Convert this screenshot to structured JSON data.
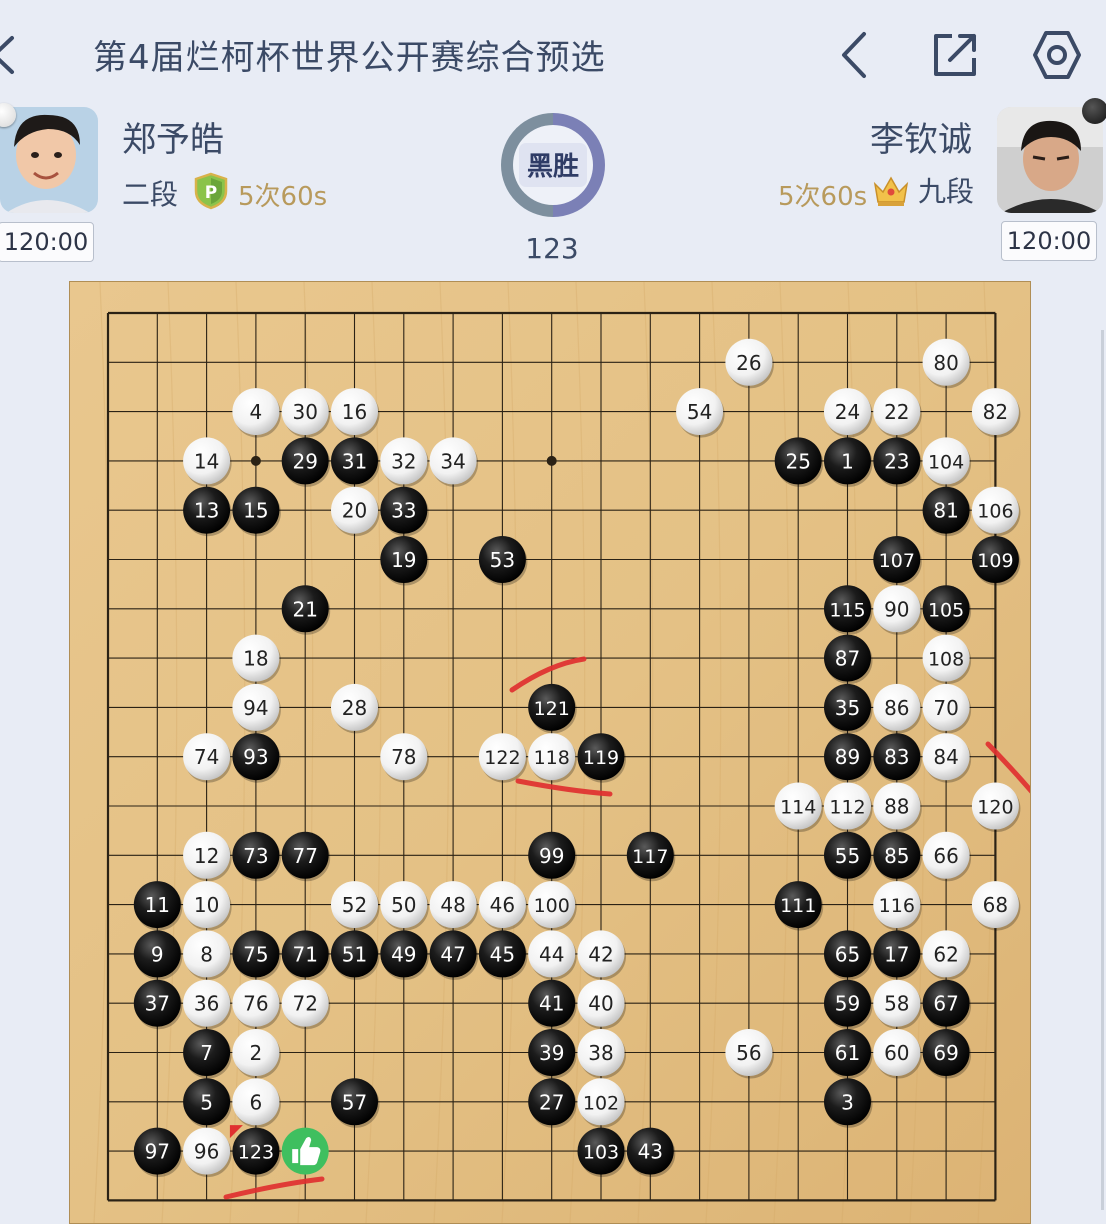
{
  "header": {
    "title": "第4届烂柯杯世界公开赛综合预选",
    "back_icon": "chevron-left-icon",
    "prev_icon": "chevron-left-icon",
    "share_icon": "share-icon",
    "settings_icon": "gear-icon"
  },
  "players": {
    "black": {
      "name": "郑予皓",
      "rank": "二段",
      "byoyomi": "5次60s",
      "clock": "120:00",
      "badge_icon": "p-shield-icon"
    },
    "white": {
      "name": "李钦诚",
      "rank": "九段",
      "byoyomi": "5次60s",
      "clock": "120:00",
      "badge_icon": "crown-icon"
    }
  },
  "result": {
    "label": "黑胜",
    "move_count": "123"
  },
  "colors": {
    "black_stone": "#1c1c1c",
    "white_stone": "#f2f2f2",
    "board": "#e4c185",
    "annotation": "#e03030",
    "ring_left": "#7d8f9e",
    "ring_right": "#7b80b6"
  },
  "board": {
    "size": 19,
    "stones": [
      {
        "n": "26",
        "c": "w",
        "col": 13,
        "row": 1
      },
      {
        "n": "80",
        "c": "w",
        "col": 17,
        "row": 1
      },
      {
        "n": "4",
        "c": "w",
        "col": 3,
        "row": 2
      },
      {
        "n": "30",
        "c": "w",
        "col": 4,
        "row": 2
      },
      {
        "n": "16",
        "c": "w",
        "col": 5,
        "row": 2
      },
      {
        "n": "54",
        "c": "w",
        "col": 12,
        "row": 2
      },
      {
        "n": "24",
        "c": "w",
        "col": 15,
        "row": 2
      },
      {
        "n": "22",
        "c": "w",
        "col": 16,
        "row": 2
      },
      {
        "n": "82",
        "c": "w",
        "col": 18,
        "row": 2
      },
      {
        "n": "14",
        "c": "w",
        "col": 2,
        "row": 3
      },
      {
        "n": "29",
        "c": "b",
        "col": 4,
        "row": 3
      },
      {
        "n": "31",
        "c": "b",
        "col": 5,
        "row": 3
      },
      {
        "n": "32",
        "c": "w",
        "col": 6,
        "row": 3
      },
      {
        "n": "34",
        "c": "w",
        "col": 7,
        "row": 3
      },
      {
        "n": "25",
        "c": "b",
        "col": 14,
        "row": 3
      },
      {
        "n": "1",
        "c": "b",
        "col": 15,
        "row": 3
      },
      {
        "n": "23",
        "c": "b",
        "col": 16,
        "row": 3
      },
      {
        "n": "104",
        "c": "w",
        "col": 17,
        "row": 3
      },
      {
        "n": "13",
        "c": "b",
        "col": 2,
        "row": 4
      },
      {
        "n": "15",
        "c": "b",
        "col": 3,
        "row": 4
      },
      {
        "n": "20",
        "c": "w",
        "col": 5,
        "row": 4
      },
      {
        "n": "33",
        "c": "b",
        "col": 6,
        "row": 4
      },
      {
        "n": "81",
        "c": "b",
        "col": 17,
        "row": 4
      },
      {
        "n": "106",
        "c": "w",
        "col": 18,
        "row": 4
      },
      {
        "n": "19",
        "c": "b",
        "col": 6,
        "row": 5
      },
      {
        "n": "53",
        "c": "b",
        "col": 8,
        "row": 5
      },
      {
        "n": "107",
        "c": "b",
        "col": 16,
        "row": 5
      },
      {
        "n": "109",
        "c": "b",
        "col": 18,
        "row": 5
      },
      {
        "n": "21",
        "c": "b",
        "col": 4,
        "row": 6
      },
      {
        "n": "115",
        "c": "b",
        "col": 15,
        "row": 6
      },
      {
        "n": "90",
        "c": "w",
        "col": 16,
        "row": 6
      },
      {
        "n": "105",
        "c": "b",
        "col": 17,
        "row": 6
      },
      {
        "n": "18",
        "c": "w",
        "col": 3,
        "row": 7
      },
      {
        "n": "87",
        "c": "b",
        "col": 15,
        "row": 7
      },
      {
        "n": "108",
        "c": "w",
        "col": 17,
        "row": 7
      },
      {
        "n": "94",
        "c": "w",
        "col": 3,
        "row": 8
      },
      {
        "n": "28",
        "c": "w",
        "col": 5,
        "row": 8
      },
      {
        "n": "121",
        "c": "b",
        "col": 9,
        "row": 8
      },
      {
        "n": "35",
        "c": "b",
        "col": 15,
        "row": 8
      },
      {
        "n": "86",
        "c": "w",
        "col": 16,
        "row": 8
      },
      {
        "n": "70",
        "c": "w",
        "col": 17,
        "row": 8
      },
      {
        "n": "74",
        "c": "w",
        "col": 2,
        "row": 9
      },
      {
        "n": "93",
        "c": "b",
        "col": 3,
        "row": 9
      },
      {
        "n": "78",
        "c": "w",
        "col": 6,
        "row": 9
      },
      {
        "n": "122",
        "c": "w",
        "col": 8,
        "row": 9
      },
      {
        "n": "118",
        "c": "w",
        "col": 9,
        "row": 9
      },
      {
        "n": "119",
        "c": "b",
        "col": 10,
        "row": 9
      },
      {
        "n": "89",
        "c": "b",
        "col": 15,
        "row": 9
      },
      {
        "n": "83",
        "c": "b",
        "col": 16,
        "row": 9
      },
      {
        "n": "84",
        "c": "w",
        "col": 17,
        "row": 9
      },
      {
        "n": "114",
        "c": "w",
        "col": 14,
        "row": 10
      },
      {
        "n": "112",
        "c": "w",
        "col": 15,
        "row": 10
      },
      {
        "n": "88",
        "c": "w",
        "col": 16,
        "row": 10
      },
      {
        "n": "120",
        "c": "w",
        "col": 18,
        "row": 10
      },
      {
        "n": "12",
        "c": "w",
        "col": 2,
        "row": 11
      },
      {
        "n": "73",
        "c": "b",
        "col": 3,
        "row": 11
      },
      {
        "n": "77",
        "c": "b",
        "col": 4,
        "row": 11
      },
      {
        "n": "99",
        "c": "b",
        "col": 9,
        "row": 11
      },
      {
        "n": "117",
        "c": "b",
        "col": 11,
        "row": 11
      },
      {
        "n": "55",
        "c": "b",
        "col": 15,
        "row": 11
      },
      {
        "n": "85",
        "c": "b",
        "col": 16,
        "row": 11
      },
      {
        "n": "66",
        "c": "w",
        "col": 17,
        "row": 11
      },
      {
        "n": "11",
        "c": "b",
        "col": 1,
        "row": 12
      },
      {
        "n": "10",
        "c": "w",
        "col": 2,
        "row": 12
      },
      {
        "n": "52",
        "c": "w",
        "col": 5,
        "row": 12
      },
      {
        "n": "50",
        "c": "w",
        "col": 6,
        "row": 12
      },
      {
        "n": "48",
        "c": "w",
        "col": 7,
        "row": 12
      },
      {
        "n": "46",
        "c": "w",
        "col": 8,
        "row": 12
      },
      {
        "n": "100",
        "c": "w",
        "col": 9,
        "row": 12
      },
      {
        "n": "111",
        "c": "b",
        "col": 14,
        "row": 12
      },
      {
        "n": "116",
        "c": "w",
        "col": 16,
        "row": 12
      },
      {
        "n": "68",
        "c": "w",
        "col": 18,
        "row": 12
      },
      {
        "n": "9",
        "c": "b",
        "col": 1,
        "row": 13
      },
      {
        "n": "8",
        "c": "w",
        "col": 2,
        "row": 13
      },
      {
        "n": "75",
        "c": "b",
        "col": 3,
        "row": 13
      },
      {
        "n": "71",
        "c": "b",
        "col": 4,
        "row": 13
      },
      {
        "n": "51",
        "c": "b",
        "col": 5,
        "row": 13
      },
      {
        "n": "49",
        "c": "b",
        "col": 6,
        "row": 13
      },
      {
        "n": "47",
        "c": "b",
        "col": 7,
        "row": 13
      },
      {
        "n": "45",
        "c": "b",
        "col": 8,
        "row": 13
      },
      {
        "n": "44",
        "c": "w",
        "col": 9,
        "row": 13
      },
      {
        "n": "42",
        "c": "w",
        "col": 10,
        "row": 13
      },
      {
        "n": "65",
        "c": "b",
        "col": 15,
        "row": 13
      },
      {
        "n": "17",
        "c": "b",
        "col": 16,
        "row": 13
      },
      {
        "n": "62",
        "c": "w",
        "col": 17,
        "row": 13
      },
      {
        "n": "37",
        "c": "b",
        "col": 1,
        "row": 14
      },
      {
        "n": "36",
        "c": "w",
        "col": 2,
        "row": 14
      },
      {
        "n": "76",
        "c": "w",
        "col": 3,
        "row": 14
      },
      {
        "n": "72",
        "c": "w",
        "col": 4,
        "row": 14
      },
      {
        "n": "41",
        "c": "b",
        "col": 9,
        "row": 14
      },
      {
        "n": "40",
        "c": "w",
        "col": 10,
        "row": 14
      },
      {
        "n": "59",
        "c": "b",
        "col": 15,
        "row": 14
      },
      {
        "n": "58",
        "c": "w",
        "col": 16,
        "row": 14
      },
      {
        "n": "67",
        "c": "b",
        "col": 17,
        "row": 14
      },
      {
        "n": "7",
        "c": "b",
        "col": 2,
        "row": 15
      },
      {
        "n": "2",
        "c": "w",
        "col": 3,
        "row": 15
      },
      {
        "n": "39",
        "c": "b",
        "col": 9,
        "row": 15
      },
      {
        "n": "38",
        "c": "w",
        "col": 10,
        "row": 15
      },
      {
        "n": "56",
        "c": "w",
        "col": 13,
        "row": 15
      },
      {
        "n": "61",
        "c": "b",
        "col": 15,
        "row": 15
      },
      {
        "n": "60",
        "c": "w",
        "col": 16,
        "row": 15
      },
      {
        "n": "69",
        "c": "b",
        "col": 17,
        "row": 15
      },
      {
        "n": "5",
        "c": "b",
        "col": 2,
        "row": 16
      },
      {
        "n": "6",
        "c": "w",
        "col": 3,
        "row": 16
      },
      {
        "n": "57",
        "c": "b",
        "col": 5,
        "row": 16
      },
      {
        "n": "27",
        "c": "b",
        "col": 9,
        "row": 16
      },
      {
        "n": "102",
        "c": "w",
        "col": 10,
        "row": 16
      },
      {
        "n": "3",
        "c": "b",
        "col": 15,
        "row": 16
      },
      {
        "n": "97",
        "c": "b",
        "col": 1,
        "row": 17
      },
      {
        "n": "96",
        "c": "w",
        "col": 2,
        "row": 17
      },
      {
        "n": "123",
        "c": "b",
        "col": 3,
        "row": 17
      },
      {
        "n": "103",
        "c": "b",
        "col": 10,
        "row": 17
      },
      {
        "n": "43",
        "c": "b",
        "col": 11,
        "row": 17
      }
    ],
    "last_move": {
      "col": 3,
      "row": 17
    },
    "like_marker": {
      "icon": "thumbs-up-icon",
      "col": 4,
      "row": 17
    }
  }
}
